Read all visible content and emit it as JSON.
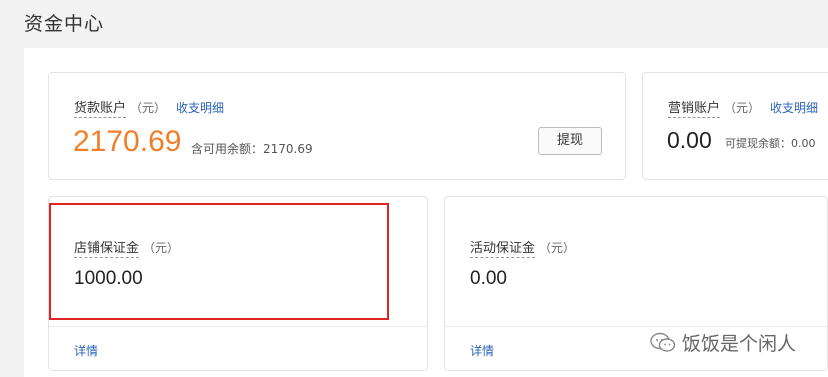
{
  "page": {
    "title": "资金中心"
  },
  "goods_account": {
    "label": "货款账户",
    "unit": "（元）",
    "link": "收支明细",
    "amount": "2170.69",
    "available": "含可用余额：2170.69",
    "withdraw_button": "提现"
  },
  "marketing_account": {
    "label": "营销账户",
    "unit": "（元）",
    "link": "收支明细",
    "amount": "0.00",
    "withdrawable": "可提现余额：0.00"
  },
  "store_deposit": {
    "label": "店铺保证金",
    "unit": "（元）",
    "amount": "1000.00",
    "details_link": "详情"
  },
  "activity_deposit": {
    "label": "活动保证金",
    "unit": "（元）",
    "amount": "0.00",
    "details_link": "详情"
  },
  "watermark": {
    "text": "饭饭是个闲人",
    "icon": "wechat-icon"
  },
  "colors": {
    "accent_orange": "#f07f2c",
    "link_blue": "#2a63b8",
    "highlight_red": "#e02424"
  }
}
